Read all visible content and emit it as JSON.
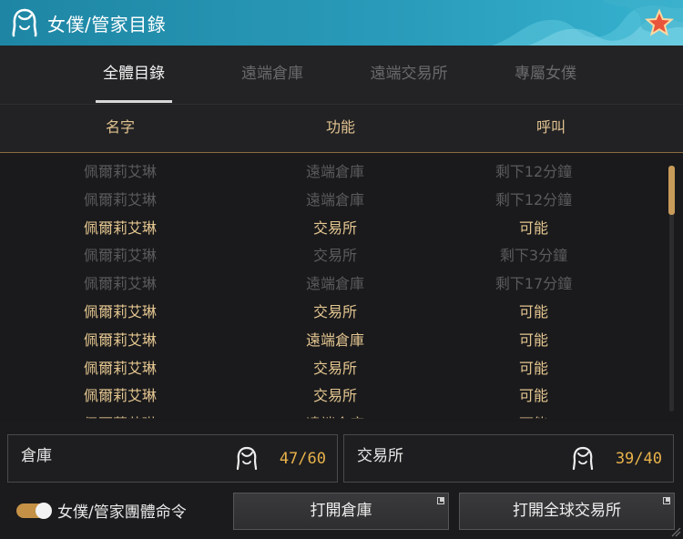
{
  "window": {
    "title": "女僕/管家目錄",
    "title_icon": "maid-head-icon",
    "favorite_icon": "star-icon"
  },
  "tabs": [
    {
      "label": "全體目錄",
      "active": true
    },
    {
      "label": "遠端倉庫",
      "active": false
    },
    {
      "label": "遠端交易所",
      "active": false
    },
    {
      "label": "專屬女僕",
      "active": false
    }
  ],
  "table": {
    "headers": {
      "name": "名字",
      "function": "功能",
      "call": "呼叫"
    },
    "rows": [
      {
        "name": "佩爾莉艾琳",
        "function": "遠端倉庫",
        "call": "剩下12分鐘",
        "available": false
      },
      {
        "name": "佩爾莉艾琳",
        "function": "遠端倉庫",
        "call": "剩下12分鐘",
        "available": false
      },
      {
        "name": "佩爾莉艾琳",
        "function": "交易所",
        "call": "可能",
        "available": true
      },
      {
        "name": "佩爾莉艾琳",
        "function": "交易所",
        "call": "剩下3分鐘",
        "available": false
      },
      {
        "name": "佩爾莉艾琳",
        "function": "遠端倉庫",
        "call": "剩下17分鐘",
        "available": false
      },
      {
        "name": "佩爾莉艾琳",
        "function": "交易所",
        "call": "可能",
        "available": true
      },
      {
        "name": "佩爾莉艾琳",
        "function": "遠端倉庫",
        "call": "可能",
        "available": true
      },
      {
        "name": "佩爾莉艾琳",
        "function": "交易所",
        "call": "可能",
        "available": true
      },
      {
        "name": "佩爾莉艾琳",
        "function": "交易所",
        "call": "可能",
        "available": true
      },
      {
        "name": "佩爾莉艾琳",
        "function": "遠端倉庫",
        "call": "可能",
        "available": true
      }
    ]
  },
  "stats": {
    "warehouse": {
      "label": "倉庫",
      "value": "47/60"
    },
    "market": {
      "label": "交易所",
      "value": "39/40"
    }
  },
  "footer": {
    "toggle_label": "女僕/管家團體命令",
    "toggle_on": true,
    "open_warehouse": "打開倉庫",
    "open_market": "打開全球交易所"
  },
  "colors": {
    "title_bar": "#2a9cbb",
    "accent_gold": "#e4c690",
    "value_orange": "#e8b24a",
    "dim_text": "#5b5b5d"
  }
}
